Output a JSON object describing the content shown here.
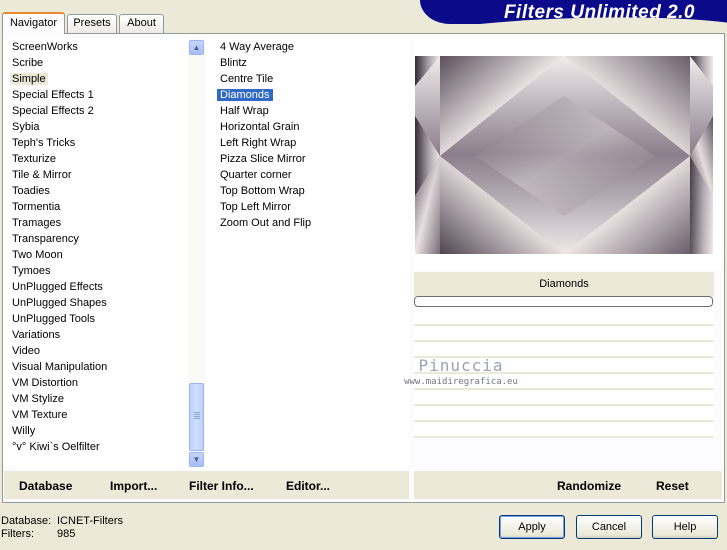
{
  "tabs": [
    {
      "label": "Navigator",
      "active": true
    },
    {
      "label": "Presets",
      "active": false
    },
    {
      "label": "About",
      "active": false
    }
  ],
  "banner": {
    "title": "Filters Unlimited 2.0",
    "color": "#0a0a8a"
  },
  "categories": {
    "items": [
      "ScreenWorks",
      "Scribe",
      "Simple",
      "Special Effects 1",
      "Special Effects 2",
      "Sybia",
      "Teph's Tricks",
      "Texturize",
      "Tile & Mirror",
      "Toadies",
      "Tormentia",
      "Tramages",
      "Transparency",
      "Two Moon",
      "Tymoes",
      "UnPlugged Effects",
      "UnPlugged Shapes",
      "UnPlugged Tools",
      "Variations",
      "Video",
      "Visual Manipulation",
      "VM Distortion",
      "VM Stylize",
      "VM Texture",
      "Willy",
      "°v° Kiwi`s Oelfilter"
    ],
    "selected": "Simple"
  },
  "filters": {
    "items": [
      "4 Way Average",
      "Blintz",
      "Centre Tile",
      "Diamonds",
      "Half Wrap",
      "Horizontal Grain",
      "Left Right Wrap",
      "Pizza Slice Mirror",
      "Quarter corner",
      "Top Bottom Wrap",
      "Top Left Mirror",
      "Zoom Out and Flip"
    ],
    "selected": "Diamonds"
  },
  "preview": {
    "filter_name": "Diamonds",
    "progress": 0,
    "colors": {
      "dark": "#4a3e4c",
      "mid": "#8a7e8c",
      "light": "#ece4e4"
    }
  },
  "watermark": {
    "name": "Pinuccia",
    "url": "www.maidiregrafica.eu"
  },
  "toolbar_left": {
    "database": "Database",
    "import": "Import...",
    "filter_info": "Filter Info...",
    "editor": "Editor..."
  },
  "toolbar_right": {
    "randomize": "Randomize",
    "reset": "Reset"
  },
  "footer": {
    "database_label": "Database:",
    "database_value": "ICNET-Filters",
    "filters_label": "Filters:",
    "filters_value": "985"
  },
  "dialog_buttons": {
    "apply": "Apply",
    "cancel": "Cancel",
    "help": "Help"
  }
}
